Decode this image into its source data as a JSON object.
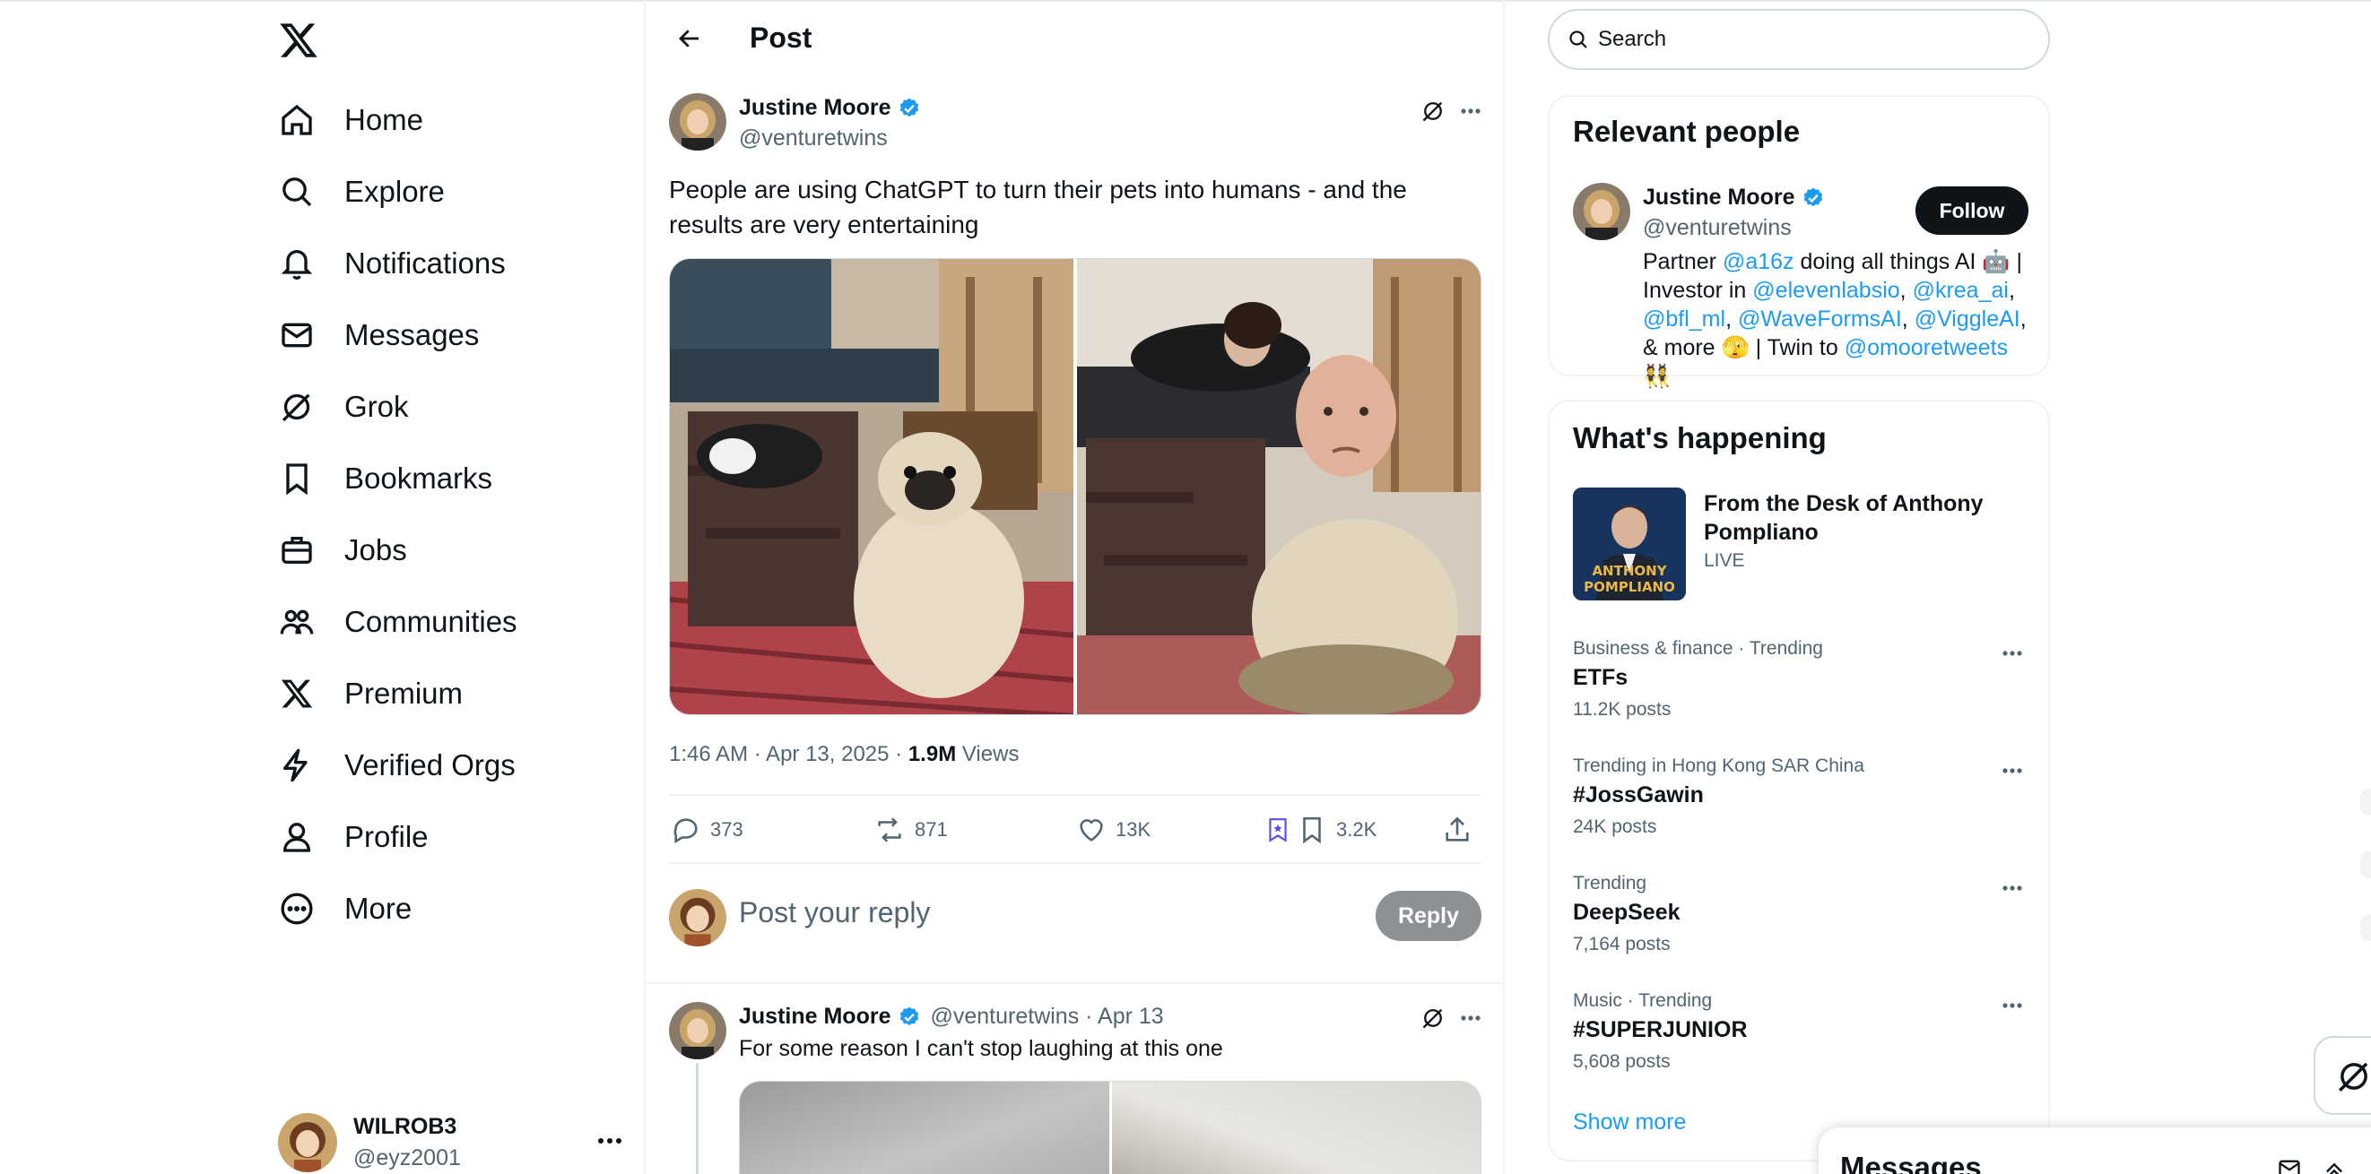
{
  "nav": {
    "logo_icon": "x-logo-icon",
    "items": [
      {
        "label": "Home",
        "icon": "home-icon"
      },
      {
        "label": "Explore",
        "icon": "search-icon"
      },
      {
        "label": "Notifications",
        "icon": "bell-icon"
      },
      {
        "label": "Messages",
        "icon": "mail-icon"
      },
      {
        "label": "Grok",
        "icon": "grok-icon"
      },
      {
        "label": "Bookmarks",
        "icon": "bookmark-icon"
      },
      {
        "label": "Jobs",
        "icon": "briefcase-icon"
      },
      {
        "label": "Communities",
        "icon": "people-icon"
      },
      {
        "label": "Premium",
        "icon": "x-icon"
      },
      {
        "label": "Verified Orgs",
        "icon": "lightning-icon"
      },
      {
        "label": "Profile",
        "icon": "person-icon"
      },
      {
        "label": "More",
        "icon": "more-circle-icon"
      }
    ]
  },
  "account": {
    "display_name": "WILROB3",
    "handle": "@eyz2001"
  },
  "header": {
    "title": "Post"
  },
  "post": {
    "author_name": "Justine Moore",
    "author_handle": "@venturetwins",
    "text": "People are using ChatGPT to turn their pets into humans - and the results are very entertaining",
    "timestamp": "1:46 AM · Apr 13, 2025 · ",
    "views_count": "1.9M",
    "views_label": " Views",
    "stats": {
      "replies": "373",
      "reposts": "871",
      "likes": "13K",
      "bookmarks": "3.2K"
    }
  },
  "reply_composer": {
    "placeholder": "Post your reply",
    "button": "Reply"
  },
  "reply": {
    "author_name": "Justine Moore",
    "meta": "@venturetwins · Apr 13",
    "text": "For some reason I can't stop laughing at this one"
  },
  "search": {
    "placeholder": "Search"
  },
  "relevant_people": {
    "title": "Relevant people",
    "name": "Justine Moore",
    "handle": "@venturetwins",
    "follow_label": "Follow",
    "bio": [
      {
        "t": "Partner ",
        "mention": false
      },
      {
        "t": "@a16z",
        "mention": true
      },
      {
        "t": " doing all things AI 🤖 | Investor in ",
        "mention": false
      },
      {
        "t": "@elevenlabsio",
        "mention": true
      },
      {
        "t": ", ",
        "mention": false
      },
      {
        "t": "@krea_ai",
        "mention": true
      },
      {
        "t": ", ",
        "mention": false
      },
      {
        "t": "@bfl_ml",
        "mention": true
      },
      {
        "t": ", ",
        "mention": false
      },
      {
        "t": "@WaveFormsAI",
        "mention": true
      },
      {
        "t": ", ",
        "mention": false
      },
      {
        "t": "@ViggleAI",
        "mention": true
      },
      {
        "t": ", & more 🫣 | Twin to ",
        "mention": false
      },
      {
        "t": "@omooretweets",
        "mention": true
      },
      {
        "t": " 👯",
        "mention": false
      }
    ]
  },
  "whats_happening": {
    "title": "What's happening",
    "live": {
      "title": "From the Desk of Anthony Pompliano",
      "tag": "LIVE",
      "thumb_text_1": "ANTHONY",
      "thumb_text_2": "POMPLIANO"
    },
    "trends": [
      {
        "context": "Business & finance · Trending",
        "topic": "ETFs",
        "posts": "11.2K posts"
      },
      {
        "context": "Trending in Hong Kong SAR China",
        "topic": "#JossGawin",
        "posts": "24K posts"
      },
      {
        "context": "Trending",
        "topic": "DeepSeek",
        "posts": "7,164 posts"
      },
      {
        "context": "Music · Trending",
        "topic": "#SUPERJUNIOR",
        "posts": "5,608 posts"
      }
    ],
    "show_more": "Show more"
  },
  "messages_drawer": {
    "title": "Messages"
  },
  "colors": {
    "accent": "#1d9bf0",
    "text": "#0f1419",
    "muted": "#536471",
    "border": "#eff3f4",
    "reply_button": "#8d9094"
  }
}
